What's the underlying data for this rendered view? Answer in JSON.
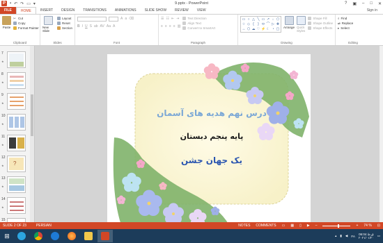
{
  "window": {
    "title": "9.pptx - PowerPoint",
    "signin": "Sign in"
  },
  "tabs": [
    "FILE",
    "HOME",
    "INSERT",
    "DESIGN",
    "TRANSITIONS",
    "ANIMATIONS",
    "SLIDE SHOW",
    "REVIEW",
    "VIEW"
  ],
  "ribbon": {
    "clipboard": {
      "label": "Clipboard",
      "paste": "Paste",
      "cut": "Cut",
      "copy": "Copy",
      "format_painter": "Format Painter"
    },
    "slides": {
      "label": "Slides",
      "new_slide": "New Slide",
      "layout": "Layout",
      "reset": "Reset",
      "section": "Section"
    },
    "font": {
      "label": "Font"
    },
    "paragraph": {
      "label": "Paragraph",
      "text_direction": "Text Direction",
      "align_text": "Align Text",
      "convert_smartart": "Convert to SmartArt"
    },
    "drawing": {
      "label": "Drawing",
      "arrange": "Arrange",
      "quick_styles": "Quick Styles",
      "shape_fill": "Shape Fill",
      "shape_outline": "Shape Outline",
      "shape_effects": "Shape Effects"
    },
    "editing": {
      "label": "Editing",
      "find": "Find",
      "replace": "Replace",
      "select": "Select"
    }
  },
  "thumbnails": [
    {
      "num": "7"
    },
    {
      "num": "8"
    },
    {
      "num": "9"
    },
    {
      "num": "10"
    },
    {
      "num": "11"
    },
    {
      "num": "12"
    },
    {
      "num": "13"
    },
    {
      "num": "14"
    },
    {
      "num": "15"
    }
  ],
  "slide": {
    "title": "درس نهم هدیه های آسمان",
    "line2": "پایه پنجم دبستان",
    "line3": "یک جهان جشن"
  },
  "statusbar": {
    "slide_count": "SLIDE 2 OF 23",
    "language": "PERSIAN",
    "notes": "NOTES",
    "comments": "COMMENTS",
    "zoom": "74 %"
  },
  "taskbar": {
    "time": "06:04 ق.ظ",
    "date": "۲۰۲۱/۰۱/۲۰",
    "lang": "FA"
  },
  "colors": {
    "accent": "#d24726",
    "taskbar": "#1c3c5a",
    "slide_title": "#7aa7d6",
    "slide_line2": "#1a1a1a",
    "slide_line3": "#2a55b0"
  }
}
